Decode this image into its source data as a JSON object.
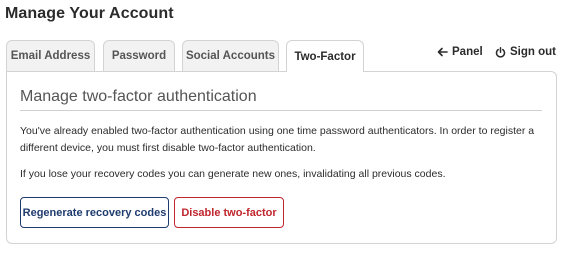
{
  "page": {
    "title": "Manage Your Account"
  },
  "tabs": [
    {
      "label": "Email Address",
      "active": false
    },
    {
      "label": "Password",
      "active": false
    },
    {
      "label": "Social Accounts",
      "active": false
    },
    {
      "label": "Two-Factor",
      "active": true
    }
  ],
  "top_links": {
    "panel": {
      "label": "Panel",
      "icon": "arrow-left-icon"
    },
    "sign_out": {
      "label": "Sign out",
      "icon": "power-icon"
    }
  },
  "section": {
    "title": "Manage two-factor authentication",
    "paragraph_1": "You've already enabled two-factor authentication using one time password authenticators. In order to register a different device, you must first disable two-factor authentication.",
    "paragraph_2": "If you lose your recovery codes you can generate new ones, invalidating all previous codes."
  },
  "buttons": {
    "regenerate": "Regenerate recovery codes",
    "disable": "Disable two-factor"
  },
  "colors": {
    "primary_outline": "#1f3b6e",
    "danger_outline": "#c0262d",
    "border": "#d3d3d3",
    "inactive_tab_bg": "#f2f2f2"
  }
}
